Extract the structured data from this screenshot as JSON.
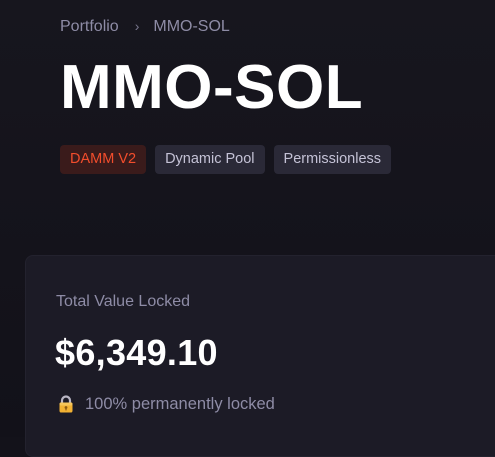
{
  "breadcrumb": {
    "items": [
      "Portfolio",
      "MMO-SOL"
    ],
    "separator": "›"
  },
  "page": {
    "title": "MMO-SOL"
  },
  "tags": [
    {
      "label": "DAMM V2",
      "color": "#f24d2c"
    },
    {
      "label": "Dynamic Pool"
    },
    {
      "label": "Permissionless"
    }
  ],
  "tvl_card": {
    "label": "Total Value Locked",
    "value": "$6,349.10",
    "lock_icon": "lock-icon",
    "lock_text": "100% permanently locked"
  }
}
